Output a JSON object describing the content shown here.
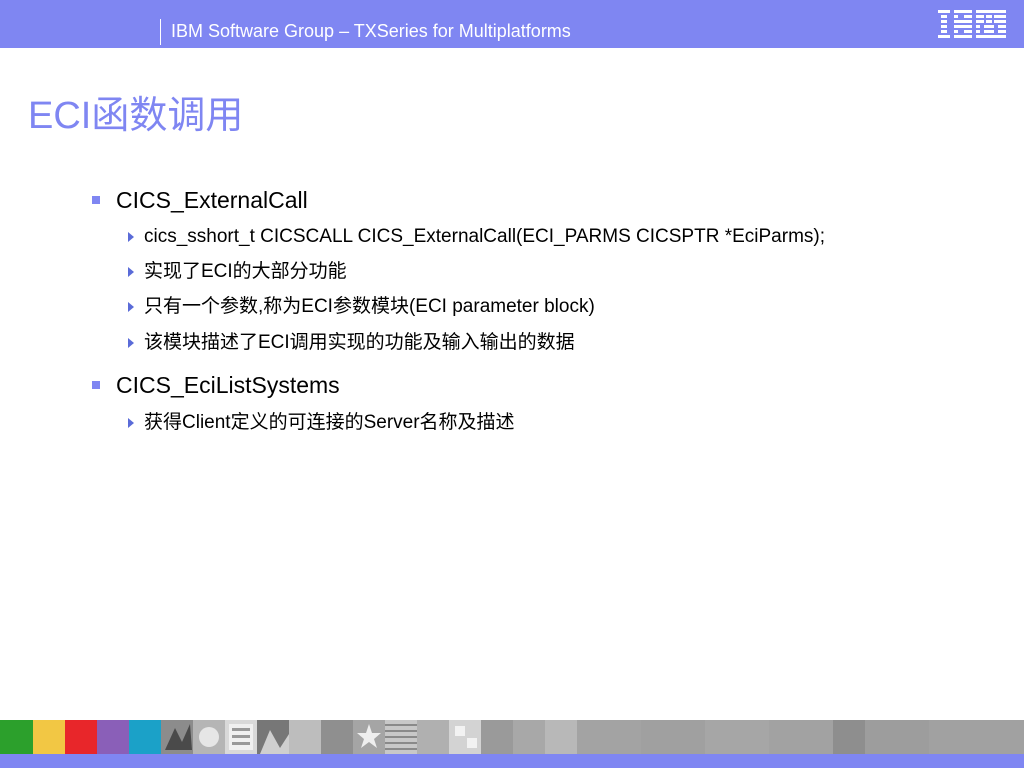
{
  "header": {
    "text": "IBM Software Group – TXSeries for Multiplatforms",
    "logo_text": "IBM",
    "background": "#7f86f2"
  },
  "title": "ECI函数调用",
  "accent_color": "#7f86f2",
  "bullets": [
    {
      "label": "CICS_ExternalCall",
      "subitems": [
        "cics_sshort_t CICSCALL CICS_ExternalCall(ECI_PARMS CICSPTR *EciParms);",
        "实现了ECI的大部分功能",
        "只有一个参数,称为ECI参数模块(ECI parameter block)",
        "该模块描述了ECI调用实现的功能及输入输出的数据"
      ]
    },
    {
      "label": "CICS_EciListSystems",
      "subitems": [
        "获得Client定义的可连接的Server名称及描述"
      ]
    }
  ],
  "footer_colors": [
    "#2ca02c",
    "#f2c744",
    "#e8262a",
    "#8a5fb8",
    "#1ba1c8"
  ]
}
